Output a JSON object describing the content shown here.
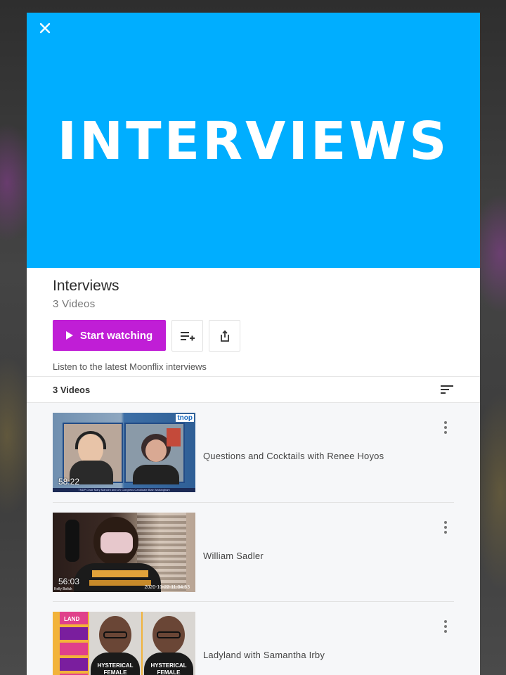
{
  "hero": {
    "title": "INTERVIEWS"
  },
  "playlist": {
    "title": "Interviews",
    "count": "3 Videos",
    "start_label": "Start watching",
    "description": "Listen to the latest Moonflix interviews"
  },
  "list": {
    "count_label": "3 Videos",
    "videos": [
      {
        "title": "Questions and Cocktails with Renee Hoyos",
        "duration": "58:22",
        "badge": "tnop",
        "caption": "TNDP Chair Mary Mancini and US Congress Candidate Blair Walsingham"
      },
      {
        "title": "William Sadler",
        "duration": "56:03",
        "overlay_name": "Kelly Bolick",
        "timestamp": "2020-10-22 11:04:53"
      },
      {
        "title": "Ladyland with Samantha Irby",
        "shirt_text": "HYSTERICAL FEMALE",
        "sticker_text": "LAND"
      }
    ]
  },
  "icons": {
    "close": "close-icon",
    "play": "play-icon",
    "add_to_queue": "playlist-add-icon",
    "share": "share-icon",
    "sort": "sort-icon",
    "more": "more-vertical-icon"
  },
  "colors": {
    "hero_bg": "#00aeff",
    "accent": "#c01ed6"
  }
}
